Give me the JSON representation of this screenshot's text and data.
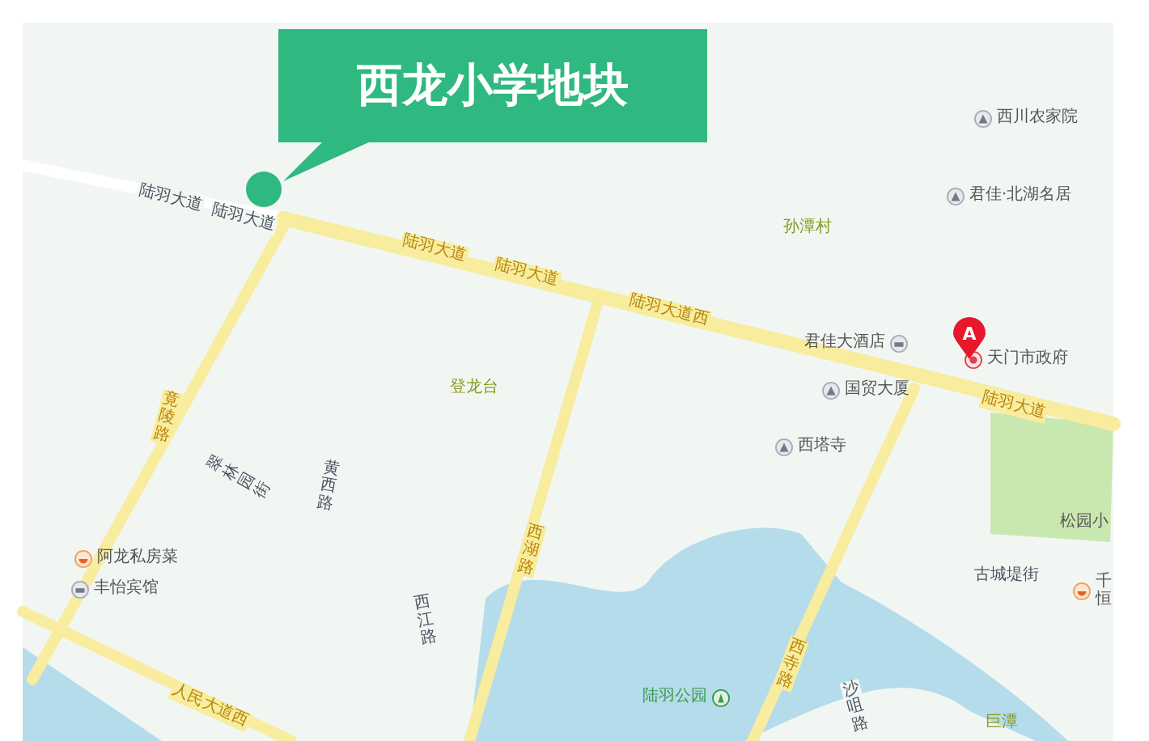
{
  "callout": {
    "title": "西龙小学地块"
  },
  "marker": {
    "letter": "A"
  },
  "map_labels": [
    {
      "text": "陆羽大道",
      "kind": "minor-road"
    },
    {
      "text": "陆羽大道",
      "kind": "minor-road"
    },
    {
      "text": "陆羽大道",
      "kind": "road"
    },
    {
      "text": "陆羽大道",
      "kind": "road"
    },
    {
      "text": "陆羽大道西",
      "kind": "road"
    },
    {
      "text": "孙潭村",
      "kind": "area"
    },
    {
      "text": "西川农家院",
      "kind": "poi"
    },
    {
      "text": "君佳·北湖名居",
      "kind": "poi"
    },
    {
      "text": "君佳大酒店",
      "kind": "hotel"
    },
    {
      "text": "天门市政府",
      "kind": "government"
    },
    {
      "text": "陆羽大道",
      "kind": "road"
    },
    {
      "text": "国贸大厦",
      "kind": "poi"
    },
    {
      "text": "西塔寺",
      "kind": "poi"
    },
    {
      "text": "登龙台",
      "kind": "area"
    },
    {
      "text": "竟陵路",
      "kind": "road"
    },
    {
      "text": "翠林园街",
      "kind": "minor-road"
    },
    {
      "text": "黄西路",
      "kind": "minor-road"
    },
    {
      "text": "西湖路",
      "kind": "road"
    },
    {
      "text": "西江路",
      "kind": "minor-road"
    },
    {
      "text": "阿龙私房菜",
      "kind": "food"
    },
    {
      "text": "丰怡宾馆",
      "kind": "hotel"
    },
    {
      "text": "人民大道西",
      "kind": "road"
    },
    {
      "text": "陆羽公园",
      "kind": "park"
    },
    {
      "text": "西寺路",
      "kind": "road"
    },
    {
      "text": "沙咀路",
      "kind": "minor-road"
    },
    {
      "text": "古城堤街",
      "kind": "minor-road"
    },
    {
      "text": "松园小",
      "kind": "plain"
    },
    {
      "text": "千恒",
      "kind": "food"
    },
    {
      "text": "巨潭",
      "kind": "area"
    }
  ]
}
